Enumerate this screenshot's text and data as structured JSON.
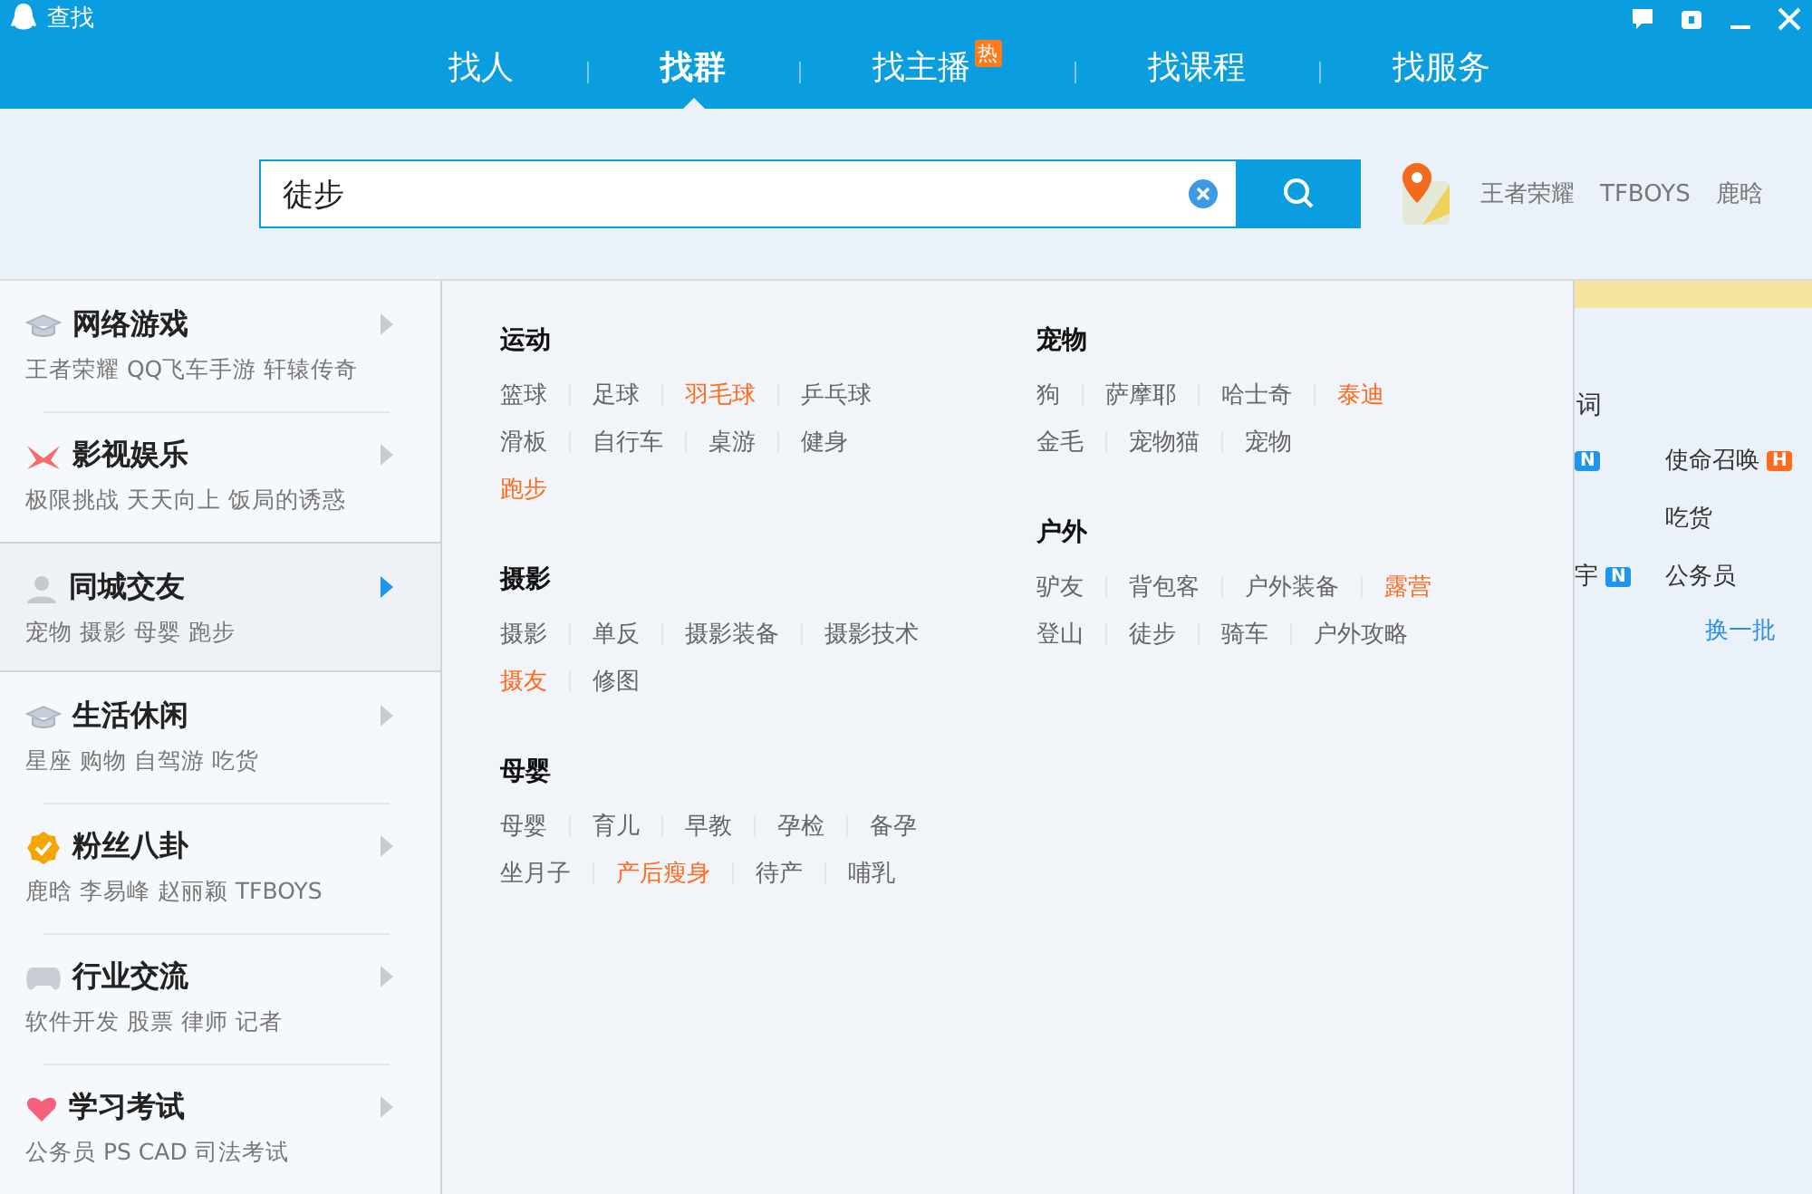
{
  "window": {
    "title": "查找"
  },
  "tabs": [
    {
      "label": "找人",
      "selected": false
    },
    {
      "label": "找群",
      "selected": true
    },
    {
      "label": "找主播",
      "selected": false,
      "badge": "热"
    },
    {
      "label": "找课程",
      "selected": false
    },
    {
      "label": "找服务",
      "selected": false
    }
  ],
  "search": {
    "value": "徒步",
    "hot_links": [
      "王者荣耀",
      "TFBOYS",
      "鹿晗"
    ]
  },
  "sidebar": {
    "items": [
      {
        "kind": "cap",
        "title": "网络游戏",
        "subtitle": "王者荣耀 QQ飞车手游 轩辕传奇",
        "selected": false
      },
      {
        "kind": "film",
        "title": "影视娱乐",
        "subtitle": "极限挑战 天天向上 饭局的诱惑",
        "selected": false
      },
      {
        "kind": "person",
        "title": "同城交友",
        "subtitle": "宠物 摄影 母婴 跑步",
        "selected": true
      },
      {
        "kind": "cap",
        "title": "生活休闲",
        "subtitle": "星座 购物 自驾游 吃货",
        "selected": false
      },
      {
        "kind": "badge",
        "title": "粉丝八卦",
        "subtitle": "鹿晗 李易峰 赵丽颖 TFBOYS",
        "selected": false
      },
      {
        "kind": "gamepad",
        "title": "行业交流",
        "subtitle": "软件开发 股票 律师 记者",
        "selected": false
      },
      {
        "kind": "heart",
        "title": "学习考试",
        "subtitle": "公务员 PS CAD 司法考试",
        "selected": false
      }
    ]
  },
  "flyout": {
    "columns": [
      [
        {
          "title": "运动",
          "rows": [
            [
              {
                "label": "篮球",
                "hot": false
              },
              {
                "label": "足球",
                "hot": false
              },
              {
                "label": "羽毛球",
                "hot": true
              },
              {
                "label": "乒乓球",
                "hot": false
              }
            ],
            [
              {
                "label": "滑板",
                "hot": false
              },
              {
                "label": "自行车",
                "hot": false
              },
              {
                "label": "桌游",
                "hot": false
              },
              {
                "label": "健身",
                "hot": false
              }
            ],
            [
              {
                "label": "跑步",
                "hot": true
              }
            ]
          ]
        },
        {
          "title": "摄影",
          "rows": [
            [
              {
                "label": "摄影",
                "hot": false
              },
              {
                "label": "单反",
                "hot": false
              },
              {
                "label": "摄影装备",
                "hot": false
              },
              {
                "label": "摄影技术",
                "hot": false
              }
            ],
            [
              {
                "label": "摄友",
                "hot": true
              },
              {
                "label": "修图",
                "hot": false
              }
            ]
          ]
        },
        {
          "title": "母婴",
          "rows": [
            [
              {
                "label": "母婴",
                "hot": false
              },
              {
                "label": "育儿",
                "hot": false
              },
              {
                "label": "早教",
                "hot": false
              },
              {
                "label": "孕检",
                "hot": false
              },
              {
                "label": "备孕",
                "hot": false
              }
            ],
            [
              {
                "label": "坐月子",
                "hot": false
              },
              {
                "label": "产后瘦身",
                "hot": true
              },
              {
                "label": "待产",
                "hot": false
              },
              {
                "label": "哺乳",
                "hot": false
              }
            ]
          ]
        }
      ],
      [
        {
          "title": "宠物",
          "rows": [
            [
              {
                "label": "狗",
                "hot": false
              },
              {
                "label": "萨摩耶",
                "hot": false
              },
              {
                "label": "哈士奇",
                "hot": false
              },
              {
                "label": "泰迪",
                "hot": true
              }
            ],
            [
              {
                "label": "金毛",
                "hot": false
              },
              {
                "label": "宠物猫",
                "hot": false
              },
              {
                "label": "宠物",
                "hot": false
              }
            ]
          ]
        },
        {
          "title": "户外",
          "rows": [
            [
              {
                "label": "驴友",
                "hot": false
              },
              {
                "label": "背包客",
                "hot": false
              },
              {
                "label": "户外装备",
                "hot": false
              },
              {
                "label": "露营",
                "hot": true
              }
            ],
            [
              {
                "label": "登山",
                "hot": false
              },
              {
                "label": "徒步",
                "hot": false
              },
              {
                "label": "骑车",
                "hot": false
              },
              {
                "label": "户外攻略",
                "hot": false
              }
            ]
          ]
        }
      ]
    ]
  },
  "hot_words": {
    "title": "词",
    "rows": [
      {
        "left": {
          "badge": "N"
        },
        "right": {
          "label": "使命召唤",
          "badge": "H"
        }
      },
      {
        "right": {
          "label": "吃货"
        }
      },
      {
        "left": {
          "label": "宇",
          "badge": "N"
        },
        "right": {
          "label": "公务员"
        }
      }
    ],
    "refresh": "换一批"
  }
}
